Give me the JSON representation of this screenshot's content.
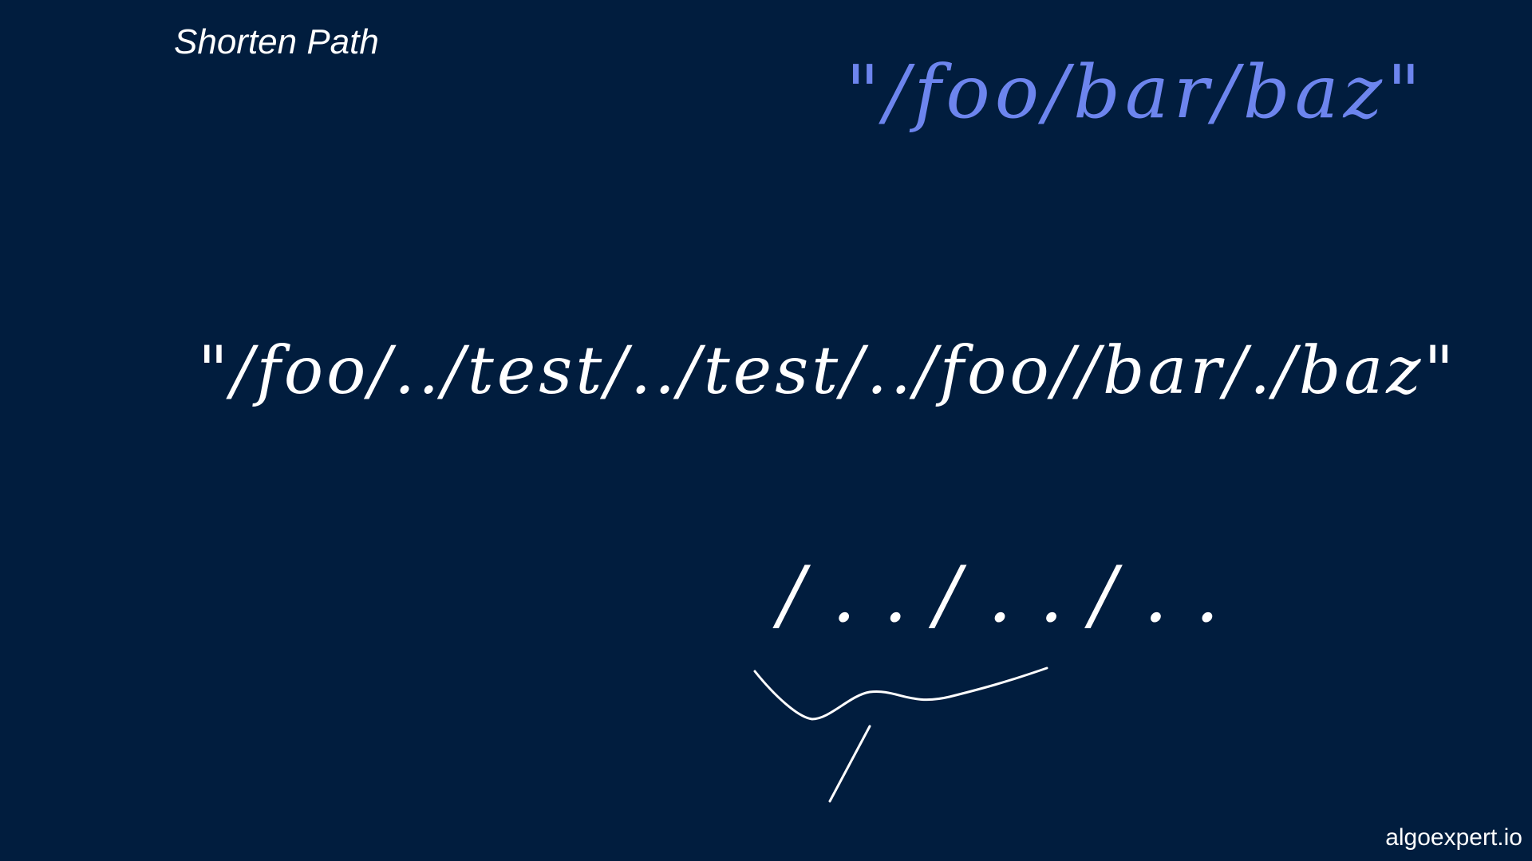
{
  "slide": {
    "title": "Shorten Path",
    "background_color": "#011d3e",
    "accent_color": "#6d85ee"
  },
  "drawing": {
    "shortened_path": "\"/foo/bar/baz\"",
    "input_path": "\"/foo/../test/../test/../foo//bar/./baz\"",
    "parent_sequence": "/../../.."
  },
  "footer": {
    "brand": "algoexpert.io"
  }
}
